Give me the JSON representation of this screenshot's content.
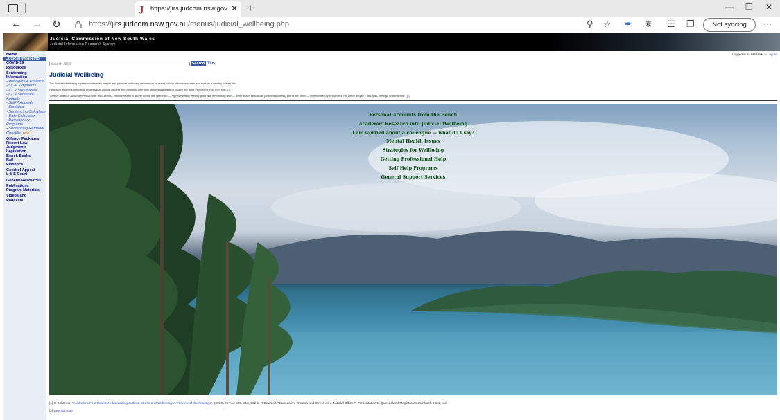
{
  "browser": {
    "tab_title": "https://jirs.judcom.nsw.gov.au/m",
    "tab_close": "✕",
    "new_tab": "+",
    "url_host_prefix": "https://",
    "url_host": "jirs.judcom.nsw.gov.au",
    "url_path": "/menus/judicial_wellbeing.php",
    "sync_label": "Not syncing",
    "more": "···",
    "minimize": "—",
    "restore": "❐",
    "close": "✕"
  },
  "site": {
    "title": "Judicial Commission of New South Wales",
    "subtitle": "Judicial Information Research System",
    "login_prefix": "Logged in as",
    "login_user": "vmrunes",
    "logout_label": "Logout",
    "search_placeholder": "Search JIRS",
    "search_button": "Search",
    "tips_label": "Tips"
  },
  "sidebar": {
    "home": "Home",
    "judicial_wellbeing": "Judicial Wellbeing",
    "covid_1": "COVID-19",
    "covid_2": "Resources",
    "sentencing_1": "Sentencing",
    "sentencing_2": "Information",
    "sub_principles": "- Principles & Practice",
    "sub_cca_judgments": "- CCA Judgments",
    "sub_cca_summaries": "- CCA Summaries",
    "sub_cca_sentence_1": "- CCA Sentence",
    "sub_cca_sentence_2": "Appeals",
    "sub_snpp": "- SNPP Appeals",
    "sub_statistics": "- Statistics",
    "sub_calculator": "- Sentencing Calculator",
    "sub_date_calc": "- Date Calculator",
    "sub_diversionary_1": "- Diversionary",
    "sub_diversionary_2": "Programs",
    "sub_remarks_1": "- Sentencing Remarks",
    "sub_remarks_2": "Checklist",
    "new_badge": "new",
    "offence_packages": "Offence Packages",
    "recent_law": "Recent Law",
    "judgments": "Judgments",
    "legislation": "Legislation",
    "bench_books": "Bench Books",
    "bail": "Bail",
    "evidence": "Evidence",
    "court_appeal": "Court of Appeal",
    "le_court": "L & E Court",
    "general_resources": "General Resources",
    "publications_1": "Publications",
    "publications_2": "Program Materials",
    "videos_1": "Videos and",
    "videos_2": "Podcasts"
  },
  "content": {
    "heading": "Judicial Wellbeing",
    "para1": "The Judicial Wellbeing portal includes both mental and physical wellbeing information to assist judicial officers maintain and sustain a healthy judicial life.",
    "para2": "Research supports anecdotal findings that judicial officers who prioritise their own wellbeing appear to source the most enjoyment from their role.",
    "para2_ref": "[1]",
    "para3": "\"Mental health is about wellness rather than illness…mental health is at one end of the spectrum — represented by feeling good and functioning well — while health conditions (or mental illness) are at the other — represented by symptoms that affect people's thoughts, feelings or behaviour.\"",
    "para3_ref": "[2]"
  },
  "menu": [
    "Personal Accounts from the Bench",
    "Academic Research into Judicial Wellbeing",
    "I am worried about a colleague — what do I say?",
    "Mental Health Issues",
    "Strategies for Wellbeing",
    "Getting Professional Help",
    "Self Help Programs",
    "General Support Services"
  ],
  "footnotes": {
    "fn1_label": "[1]",
    "fn1_text_a": "C Schrever,",
    "fn1_link": "\"Australia's First Research Measuring Judicial Stress and Wellbeing: A Preview of the Findings\"",
    "fn1_text_b": ", (2018) 92 ALJ 855, n13, 862 in H Bowskill, \"Cumulative Trauma and Stress as a Judicial Officer\", Presentation to Queensland Magistrates 25 March 2021, p 2.",
    "fn2_label": "[2]",
    "fn2_link": "Beyond Blue."
  },
  "colors": {
    "brand": "#3a5aa8",
    "menu_link": "#0b4d12",
    "heading": "#003399"
  }
}
